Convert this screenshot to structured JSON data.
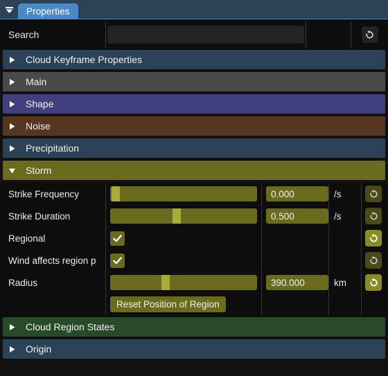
{
  "titlebar": {
    "menu_icon": "dropdown-triangle-icon",
    "tab_label": "Properties"
  },
  "search": {
    "label": "Search",
    "value": "",
    "placeholder": "",
    "reset_icon": "revert-icon"
  },
  "sections": [
    {
      "label": "Cloud Keyframe Properties",
      "color": "#2b4257",
      "expanded": false,
      "arrow": "triangle-right-icon"
    },
    {
      "label": "Main",
      "color": "#4a4a4a",
      "expanded": false,
      "arrow": "triangle-right-icon"
    },
    {
      "label": "Shape",
      "color": "#413f7d",
      "expanded": false,
      "arrow": "triangle-right-icon"
    },
    {
      "label": "Noise",
      "color": "#563521",
      "expanded": false,
      "arrow": "triangle-right-icon"
    },
    {
      "label": "Precipitation",
      "color": "#2b4257",
      "expanded": false,
      "arrow": "triangle-right-icon"
    }
  ],
  "storm": {
    "header": {
      "label": "Storm",
      "color": "#6b6b1f",
      "expanded": true,
      "arrow": "triangle-down-icon"
    },
    "rows": [
      {
        "label": "Strike Frequency",
        "widget": "slider",
        "slider_pct": 1,
        "value": "0.000",
        "unit": "/s",
        "reset_icon": "revert-icon",
        "reset_state": "dim"
      },
      {
        "label": "Strike Duration",
        "widget": "slider",
        "slider_pct": 45,
        "value": "0.500",
        "unit": "/s",
        "reset_icon": "revert-icon",
        "reset_state": "dim"
      },
      {
        "label": "Regional",
        "widget": "checkbox",
        "checked": true,
        "value": "",
        "unit": "",
        "reset_icon": "revert-icon",
        "reset_state": "bright"
      },
      {
        "label": "Wind affects region p",
        "widget": "checkbox",
        "checked": true,
        "value": "",
        "unit": "",
        "reset_icon": "revert-icon",
        "reset_state": "dim"
      },
      {
        "label": "Radius",
        "widget": "slider",
        "slider_pct": 37,
        "value": "390.000",
        "unit": "km",
        "reset_icon": "revert-icon",
        "reset_state": "bright"
      }
    ],
    "action_button": "Reset Position of Region"
  },
  "sections_bottom": [
    {
      "label": "Cloud Region States",
      "color": "#284a28",
      "expanded": false,
      "arrow": "triangle-right-icon"
    },
    {
      "label": "Origin",
      "color": "#2b4257",
      "expanded": false,
      "arrow": "triangle-right-icon"
    }
  ]
}
